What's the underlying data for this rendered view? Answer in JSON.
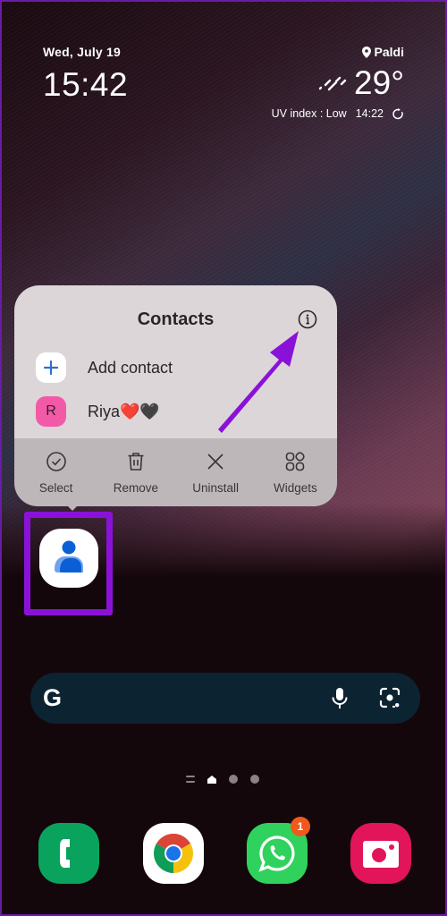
{
  "clock": {
    "date": "Wed, July 19",
    "time": "15:42"
  },
  "weather": {
    "location": "Paldi",
    "icon": "rain-icon",
    "temperature": "29°",
    "uv_label": "UV index : Low",
    "updated": "14:22",
    "refresh_icon": "refresh-icon"
  },
  "popup": {
    "title": "Contacts",
    "info_icon": "info-icon",
    "shortcuts": [
      {
        "label": "Add contact",
        "icon": "plus-icon",
        "icon_bg": "#ffffff"
      },
      {
        "label": "Riya❤️🖤",
        "avatar_letter": "R",
        "icon_bg": "#f25aa8"
      }
    ],
    "actions": [
      {
        "label": "Select",
        "icon": "check-circle-icon"
      },
      {
        "label": "Remove",
        "icon": "trash-icon"
      },
      {
        "label": "Uninstall",
        "icon": "close-icon"
      },
      {
        "label": "Widgets",
        "icon": "widgets-icon"
      }
    ]
  },
  "highlighted_app": {
    "name": "Contacts",
    "highlight_color": "#8a12d8"
  },
  "search_bar": {
    "logo": "G",
    "mic_icon": "mic-icon",
    "lens_icon": "lens-icon"
  },
  "page_indicator": {
    "pages": 3,
    "current": "home"
  },
  "dock": {
    "apps": [
      {
        "name": "Phone",
        "color": "#0aa35e"
      },
      {
        "name": "Chrome",
        "color": "#ffffff"
      },
      {
        "name": "WhatsApp",
        "color": "#2fd25c",
        "badge": "1"
      },
      {
        "name": "Camera",
        "color": "#e2155a"
      }
    ]
  },
  "annotation": {
    "arrow_color": "#8a12d8",
    "points_to": "info-icon"
  }
}
